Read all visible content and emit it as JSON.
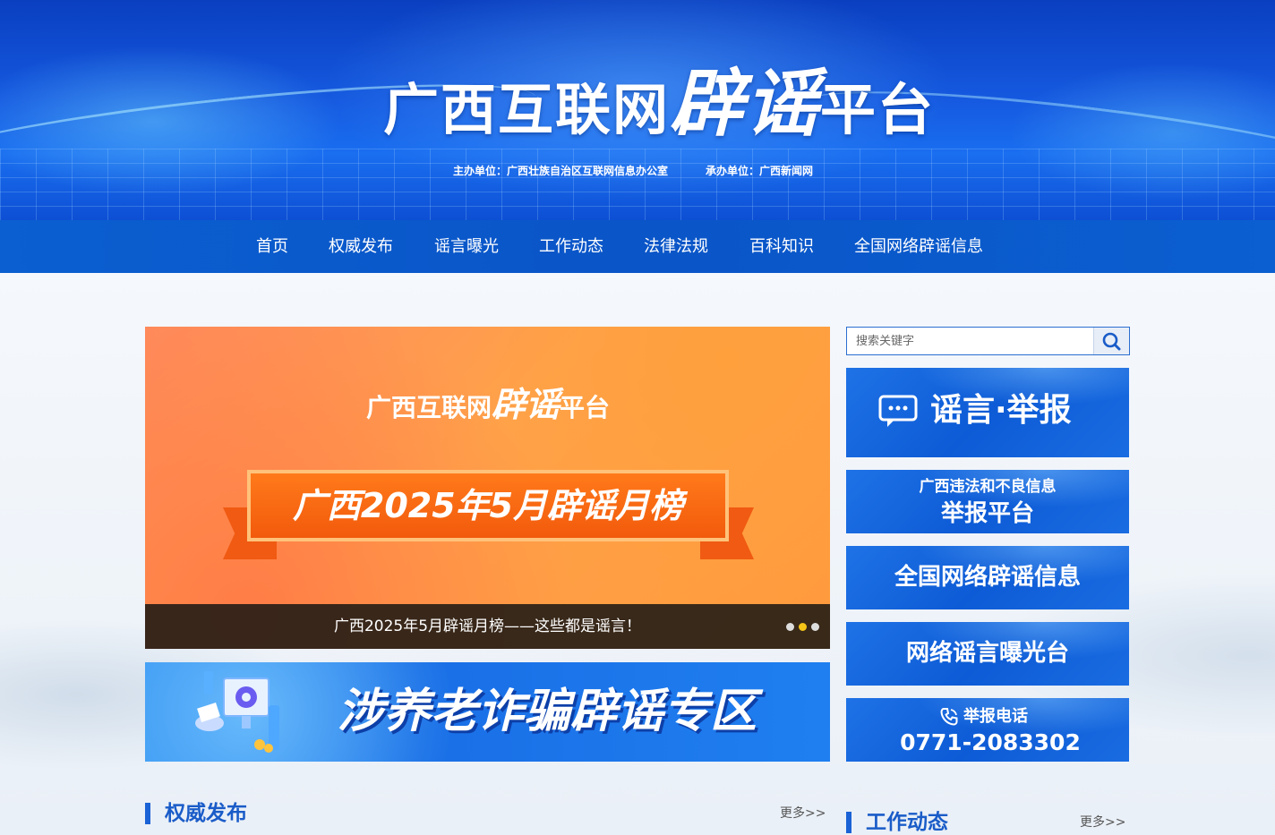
{
  "header": {
    "title_part1": "广西互联网",
    "title_big": "辟谣",
    "title_part2": "平台",
    "sponsor": "主办单位：广西壮族自治区互联网信息办公室",
    "organizer": "承办单位：广西新闻网"
  },
  "nav": {
    "items": [
      "首页",
      "权威发布",
      "谣言曝光",
      "工作动态",
      "法律法规",
      "百科知识",
      "全国网络辟谣信息"
    ]
  },
  "carousel": {
    "logo_part1": "广西互联网",
    "logo_big": "辟谣",
    "logo_part2": "平台",
    "headline": "广西2025年5月辟谣月榜",
    "caption": "广西2025年5月辟谣月榜——这些都是谣言！",
    "slide_count": 3,
    "active_index": 1
  },
  "sub_banner": {
    "text": "涉养老诈骗辟谣专区"
  },
  "search": {
    "placeholder": "搜索关键字"
  },
  "tiles": {
    "report": "谣言·举报",
    "platform_line1": "广西违法和不良信息",
    "platform_line2": "举报平台",
    "national": "全国网络辟谣信息",
    "exposure": "网络谣言曝光台",
    "phone_label": "举报电话",
    "phone_number": "0771-2083302"
  },
  "sections": {
    "left_title": "权威发布",
    "left_more": "更多>>",
    "right_title": "工作动态",
    "right_more": "更多>>"
  },
  "colors": {
    "primary_blue": "#0b5fd0",
    "accent_orange": "#f25a0c",
    "dot_active": "#f5c518"
  }
}
